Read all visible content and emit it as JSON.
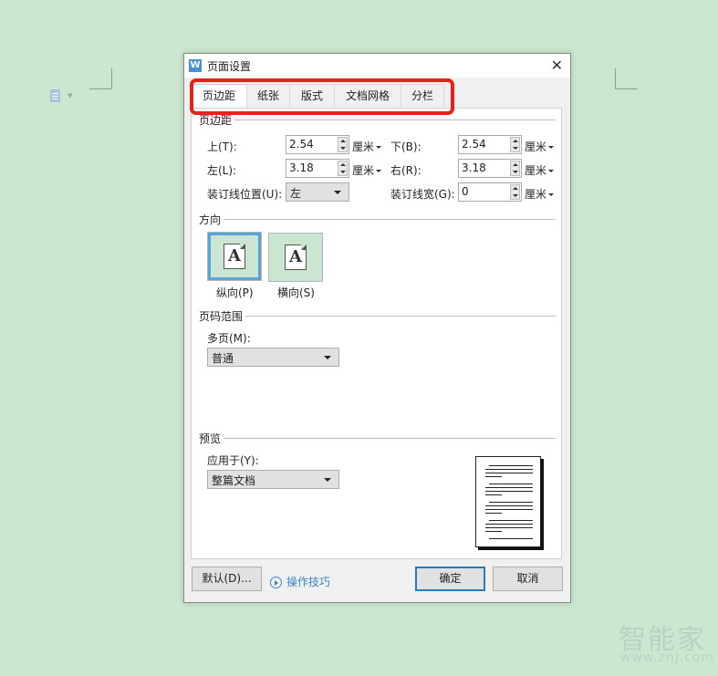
{
  "background": {
    "watermark_text": "智能家",
    "watermark_url": "www.znj.com"
  },
  "dialog": {
    "title": "页面设置",
    "app_icon_glyph": "W",
    "close_glyph": "✕",
    "highlight_color": "#e8201a",
    "tabs": [
      {
        "label": "页边距",
        "active": true
      },
      {
        "label": "纸张",
        "active": false
      },
      {
        "label": "版式",
        "active": false
      },
      {
        "label": "文档网格",
        "active": false
      },
      {
        "label": "分栏",
        "active": false
      }
    ],
    "margins": {
      "section_label": "页边距",
      "top_label": "上(T):",
      "top_value": "2.54",
      "bottom_label": "下(B):",
      "bottom_value": "2.54",
      "left_label": "左(L):",
      "left_value": "3.18",
      "right_label": "右(R):",
      "right_value": "3.18",
      "gutter_pos_label": "装订线位置(U):",
      "gutter_pos_value": "左",
      "gutter_width_label": "装订线宽(G):",
      "gutter_width_value": "0",
      "unit": "厘米"
    },
    "orientation": {
      "section_label": "方向",
      "portrait_label": "纵向(P)",
      "landscape_label": "横向(S)",
      "icon_glyph": "A",
      "selected": "portrait"
    },
    "page_range": {
      "section_label": "页码范围",
      "multi_label": "多页(M):",
      "multi_value": "普通"
    },
    "preview": {
      "section_label": "预览",
      "apply_label": "应用于(Y):",
      "apply_value": "整篇文档"
    },
    "footer": {
      "default_label": "默认(D)...",
      "tips_label": "操作技巧",
      "ok_label": "确定",
      "cancel_label": "取消"
    }
  }
}
